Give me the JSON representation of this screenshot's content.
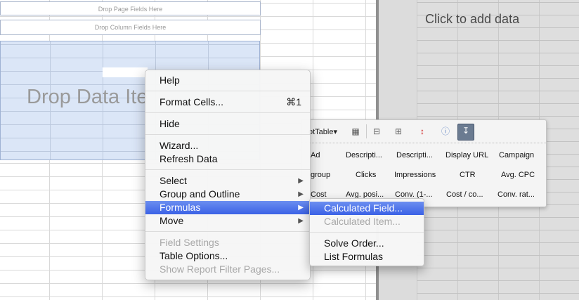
{
  "pivot_sheet": {
    "drop_page_fields": "Drop Page Fields Here",
    "drop_column_fields": "Drop Column Fields Here",
    "drop_data_items": "Drop Data Ite"
  },
  "chart": {
    "placeholder": "Click to add data"
  },
  "pivot_toolbar": {
    "label": "otTable▾",
    "fields": [
      [
        "Ad",
        "Descripti...",
        "Descripti...",
        "Display URL",
        "Campaign"
      ],
      [
        "group",
        "Clicks",
        "Impressions",
        "CTR",
        "Avg. CPC"
      ],
      [
        "Cost",
        "Avg. posi...",
        "Conv. (1-...",
        "Cost / co...",
        "Conv. rat..."
      ]
    ]
  },
  "context_menu": {
    "help": "Help",
    "format_cells": "Format Cells...",
    "format_cells_shortcut": "⌘1",
    "hide": "Hide",
    "wizard": "Wizard...",
    "refresh_data": "Refresh Data",
    "select": "Select",
    "group_and_outline": "Group and Outline",
    "formulas": "Formulas",
    "move": "Move",
    "field_settings": "Field Settings",
    "table_options": "Table Options...",
    "show_report_filter_pages": "Show Report Filter Pages..."
  },
  "formulas_submenu": {
    "calculated_field": "Calculated Field...",
    "calculated_item": "Calculated Item...",
    "solve_order": "Solve Order...",
    "list_formulas": "List Formulas"
  },
  "colors": {
    "highlight": "#3b62e6",
    "data_area": "#dbe6f7",
    "divider": "#8f8f8f"
  }
}
